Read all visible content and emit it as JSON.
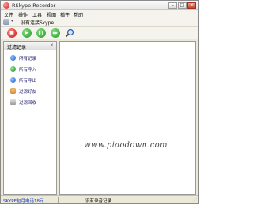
{
  "window": {
    "title": "RSkype Recorder",
    "minimize_glyph": "–",
    "maximize_glyph": "□",
    "close_glyph": "×"
  },
  "menu": {
    "items": [
      "文件",
      "操作",
      "工具",
      "视图",
      "插件",
      "帮助"
    ]
  },
  "contact_toolbar": {
    "dropdown_glyph": "▾",
    "status_label": "没有连接Skype"
  },
  "record_toolbar": {
    "stop_glyph": "■",
    "play_glyph": "▶",
    "pause_glyph": "❚❚",
    "next_glyph": "▶▶",
    "search_glyph": "🔍"
  },
  "left_panel": {
    "header": "过滤记录",
    "close_glyph": "×",
    "items": [
      {
        "label": "所有记录",
        "icon": "all-records-icon"
      },
      {
        "label": "所有呼入",
        "icon": "incoming-icon"
      },
      {
        "label": "所有呼出",
        "icon": "outgoing-icon"
      },
      {
        "label": "过滤好友",
        "icon": "filter-friends-icon"
      },
      {
        "label": "过滤回收",
        "icon": "filter-recycle-icon"
      }
    ]
  },
  "content": {
    "watermark": "www.piaodown.com"
  },
  "status": {
    "left": "SKYPE包月电话18元",
    "center": "没有录音记录"
  }
}
